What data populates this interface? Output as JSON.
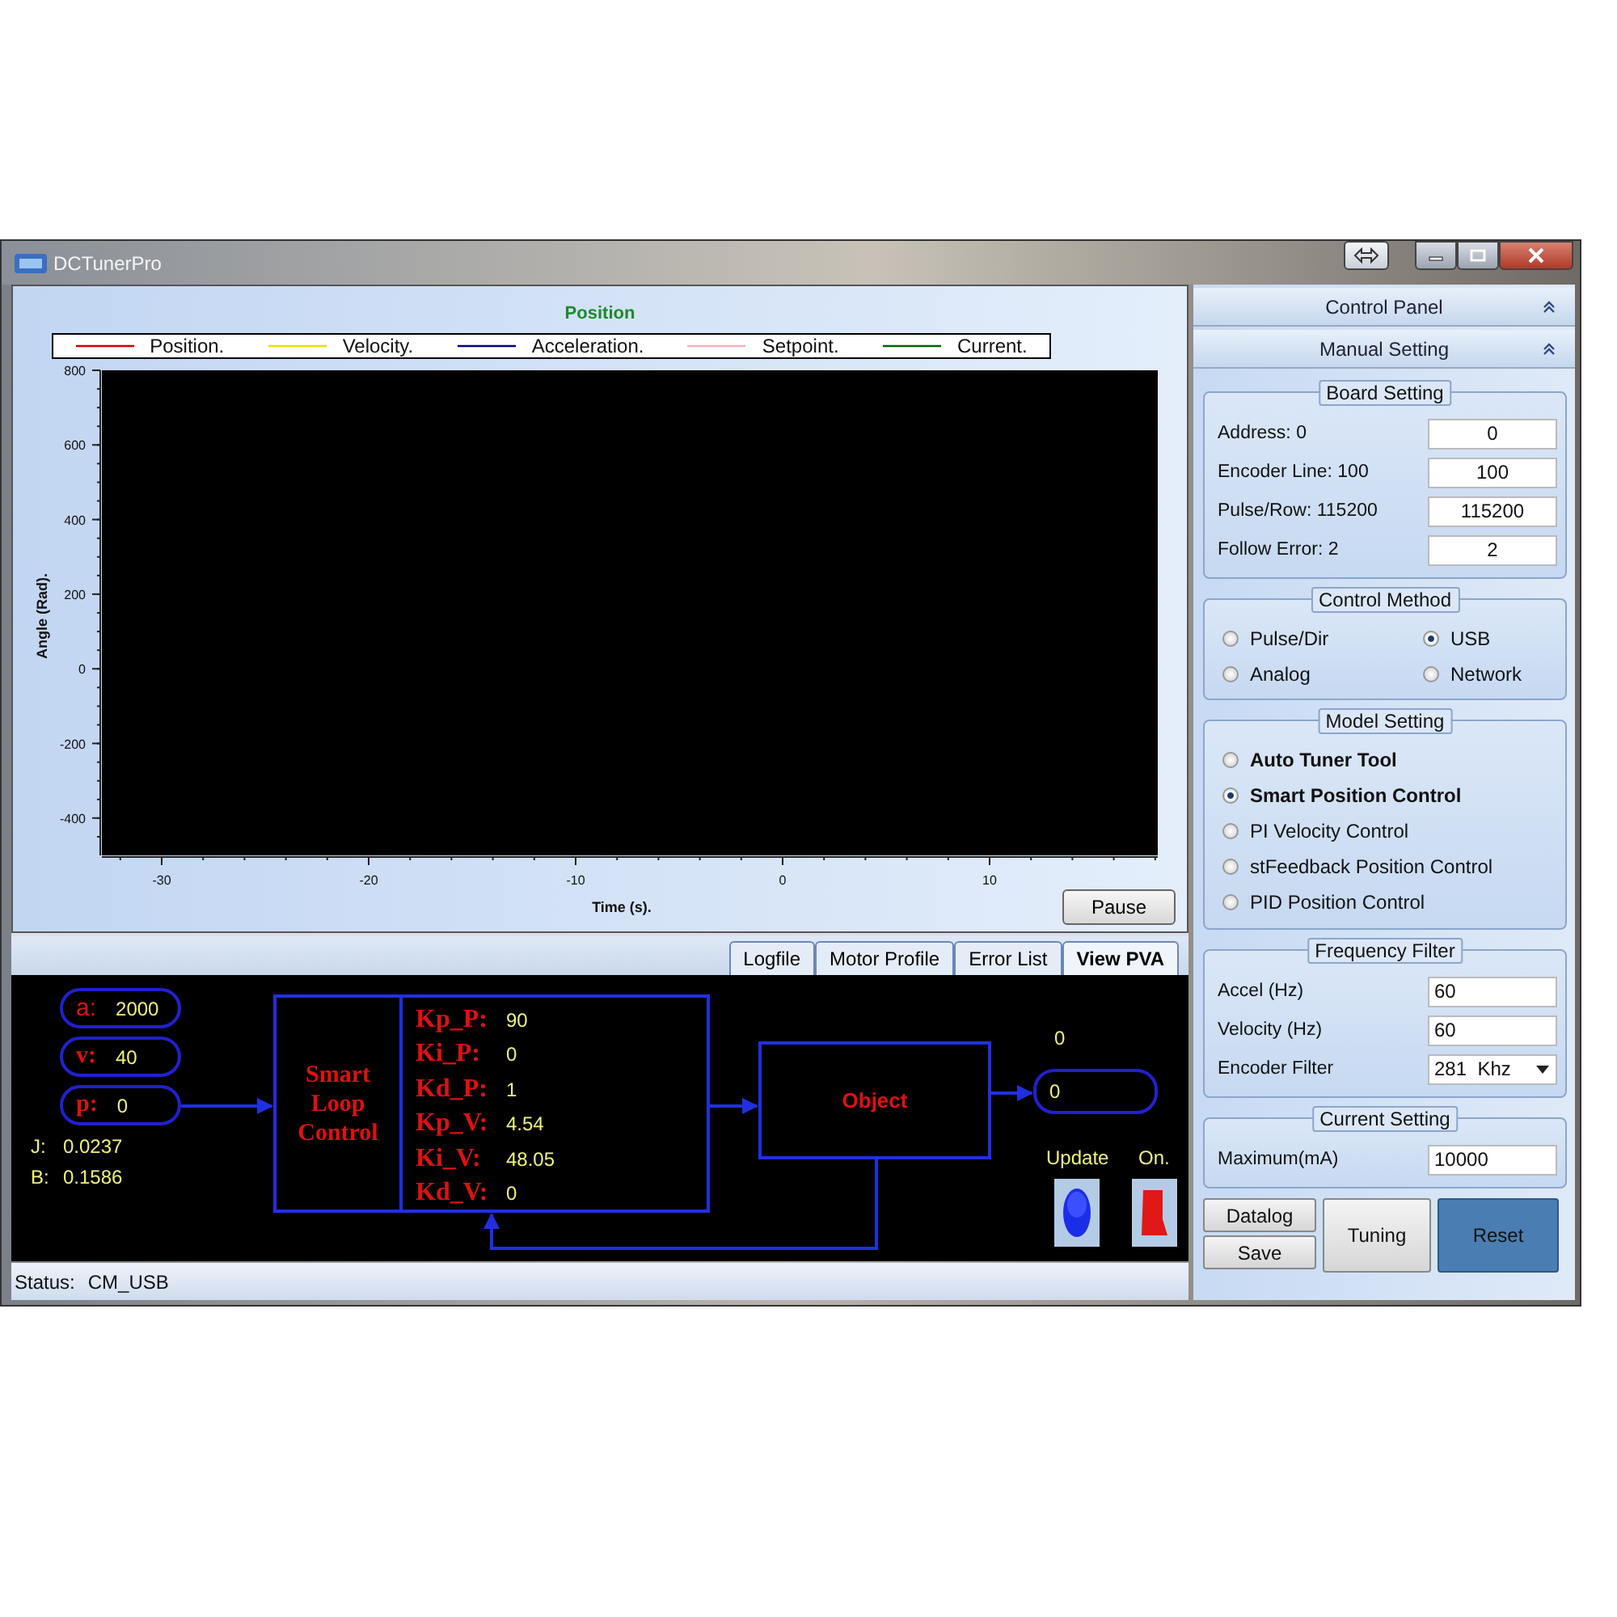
{
  "window": {
    "title": "DCTunerPro"
  },
  "chart": {
    "title": "Position",
    "pause_button": "Pause",
    "legend": [
      {
        "label": "Position.",
        "color": "#cc0000"
      },
      {
        "label": "Velocity.",
        "color": "#e8e000"
      },
      {
        "label": "Acceleration.",
        "color": "#000080"
      },
      {
        "label": "Setpoint.",
        "color": "#f0b4c0"
      },
      {
        "label": "Current.",
        "color": "#006400"
      }
    ],
    "y_axis_label": "Angle (Rad).",
    "y_tick_labels": [
      "800",
      "600",
      "400",
      "200",
      "0",
      "-200",
      "-400"
    ],
    "x_axis_label": "Time (s).",
    "x_tick_labels": [
      "-30",
      "-20",
      "-10",
      "0",
      "10"
    ]
  },
  "tabs": [
    {
      "label": "Logfile",
      "selected": false
    },
    {
      "label": "Motor Profile",
      "selected": false
    },
    {
      "label": "Error List",
      "selected": false
    },
    {
      "label": "View PVA",
      "selected": true
    }
  ],
  "diagram": {
    "inputs": [
      {
        "label": "a:",
        "value": "2000"
      },
      {
        "label": "v:",
        "value": "40"
      },
      {
        "label": "p:",
        "value": "0"
      }
    ],
    "inertia": {
      "label": "J:",
      "value": "0.0237"
    },
    "damping": {
      "label": "B:",
      "value": "0.1586"
    },
    "controller": {
      "title": "Smart Loop Control",
      "gains": [
        {
          "label": "Kp_P:",
          "value": "90"
        },
        {
          "label": "Ki_P:",
          "value": "0"
        },
        {
          "label": "Kd_P:",
          "value": "1"
        },
        {
          "label": "Kp_V:",
          "value": "4.54"
        },
        {
          "label": "Ki_V:",
          "value": "48.05"
        },
        {
          "label": "Kd_V:",
          "value": "0"
        }
      ]
    },
    "plant": "Object",
    "output_reading": "0",
    "output_value": "0",
    "update_label": "Update",
    "switch_label": "On.",
    "switch_on": true
  },
  "status_bar": {
    "label": "Status:",
    "value": "CM_USB"
  },
  "control_panel": {
    "title": "Control Panel",
    "section": "Manual Setting",
    "board_setting": {
      "title": "Board Setting",
      "fields": [
        {
          "label": "Address: 0",
          "value": "0"
        },
        {
          "label": "Encoder Line: 100",
          "value": "100"
        },
        {
          "label": "Pulse/Row: 115200",
          "value": "115200"
        },
        {
          "label": "Follow Error: 2",
          "value": "2"
        }
      ]
    },
    "control_method": {
      "title": "Control Method",
      "options": [
        {
          "label": "Pulse/Dir",
          "selected": false
        },
        {
          "label": "USB",
          "selected": true
        },
        {
          "label": "Analog",
          "selected": false
        },
        {
          "label": "Network",
          "selected": false
        }
      ]
    },
    "model_setting": {
      "title": "Model Setting",
      "options": [
        {
          "label": "Auto Tuner Tool",
          "selected": false,
          "emphasized": true
        },
        {
          "label": "Smart Position Control",
          "selected": true,
          "emphasized": true
        },
        {
          "label": "PI Velocity Control",
          "selected": false,
          "emphasized": false
        },
        {
          "label": "stFeedback Position Control",
          "selected": false,
          "emphasized": false
        },
        {
          "label": "PID Position Control",
          "selected": false,
          "emphasized": false
        }
      ]
    },
    "frequency_filter": {
      "title": "Frequency Filter",
      "fields": [
        {
          "label": "Accel (Hz)",
          "value": "60",
          "kind": "input"
        },
        {
          "label": "Velocity (Hz)",
          "value": "60",
          "kind": "input"
        },
        {
          "label": "Encoder Filter",
          "value": "281  Khz",
          "kind": "dropdown"
        }
      ]
    },
    "current_setting": {
      "title": "Current Setting",
      "fields": [
        {
          "label": "Maximum(mA)",
          "value": "10000",
          "kind": "input"
        }
      ]
    },
    "buttons": {
      "datalog": "Datalog",
      "save": "Save",
      "tuning": "Tuning",
      "reset": "Reset"
    }
  }
}
